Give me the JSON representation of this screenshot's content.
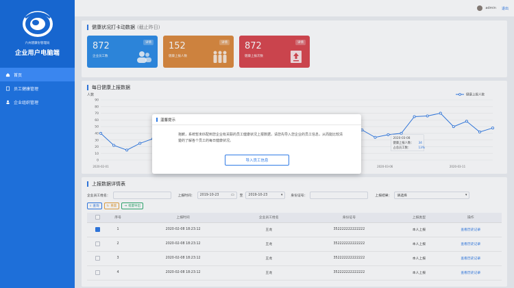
{
  "sidebar": {
    "org_name": "六州建康份管理局",
    "app_name": "企业用户电脑端",
    "items": [
      {
        "label": "首页",
        "active": true
      },
      {
        "label": "员工健康管理",
        "active": false
      },
      {
        "label": "企业组织管理",
        "active": false
      }
    ]
  },
  "topbar": {
    "user": "admin",
    "logout": "退出"
  },
  "punch": {
    "title": "健康状况打卡动数据",
    "subtitle": "(截止昨日)",
    "stats": [
      {
        "value": "872",
        "label": "企业员工数",
        "tag": "详情",
        "color": "#2e8de6"
      },
      {
        "value": "152",
        "label": "健康上报人数",
        "tag": "详情",
        "color": "#dd8a3e"
      },
      {
        "value": "872",
        "label": "健康上报次数",
        "tag": "详情",
        "color": "#d9474f"
      }
    ]
  },
  "daily": {
    "title": "每日健康上报数据",
    "legend": "健康上报人数",
    "tooltip": {
      "date": "2020-03-08",
      "line1": "健康上报人数：",
      "v1": "34",
      "line2": "占总员工数：",
      "v2": "13%"
    }
  },
  "chart_data": {
    "type": "line",
    "ylabel": "人数",
    "ylim": [
      0,
      90
    ],
    "yticks": [
      0,
      10,
      20,
      30,
      40,
      50,
      60,
      70,
      80,
      90
    ],
    "x_tick_labels": [
      "2020-02-01",
      "2020-03-06",
      "2020-03-11"
    ],
    "series": [
      {
        "name": "健康上报人数",
        "values": [
          40,
          22,
          15,
          25,
          32,
          52,
          40,
          36,
          38,
          42,
          48,
          40,
          43,
          45,
          40,
          37,
          33,
          40,
          50,
          46,
          45,
          34,
          38,
          40,
          65,
          66,
          70,
          50,
          58,
          42,
          48
        ]
      }
    ]
  },
  "modal": {
    "title": "温馨提示",
    "body": "抱歉，系统暂未匹配到您企业有关联的员工健康状况上报数据，请您先导入您企业的员工信息，从而能比较清楚的了解各个员工的每日健康状况。",
    "button": "导入员工信息"
  },
  "table": {
    "title": "上报数据详情表",
    "filters": {
      "name_label": "企业员工姓名：",
      "time_label": "上报时间：",
      "start": "2019-10-23",
      "to": "至",
      "end": "2019-10-23",
      "id_label": "身份证号：",
      "result_label": "上报结果：",
      "result_value": "请选择"
    },
    "buttons": {
      "query": "查询",
      "reset": "重置",
      "export": "批量导出"
    },
    "headers": [
      "",
      "序号",
      "上报时间",
      "企业员工姓名",
      "身份证号",
      "上报类型",
      "操作"
    ],
    "rows": [
      {
        "checked": true,
        "no": "1",
        "time": "2020-02-08 18:23:12",
        "name": "王龙",
        "id": "352222222222222",
        "type": "本人上报",
        "op": "查看历史记录"
      },
      {
        "checked": false,
        "no": "2",
        "time": "2020-02-08 18:23:12",
        "name": "王龙",
        "id": "352222222222222",
        "type": "本人上报",
        "op": "查看历史记录"
      },
      {
        "checked": false,
        "no": "3",
        "time": "2020-02-08 18:23:12",
        "name": "王龙",
        "id": "352222222222222",
        "type": "本人上报",
        "op": "查看历史记录"
      },
      {
        "checked": false,
        "no": "4",
        "time": "2020-02-08 18:23:12",
        "name": "王龙",
        "id": "352222222222222",
        "type": "本人上报",
        "op": "查看历史记录"
      }
    ]
  }
}
